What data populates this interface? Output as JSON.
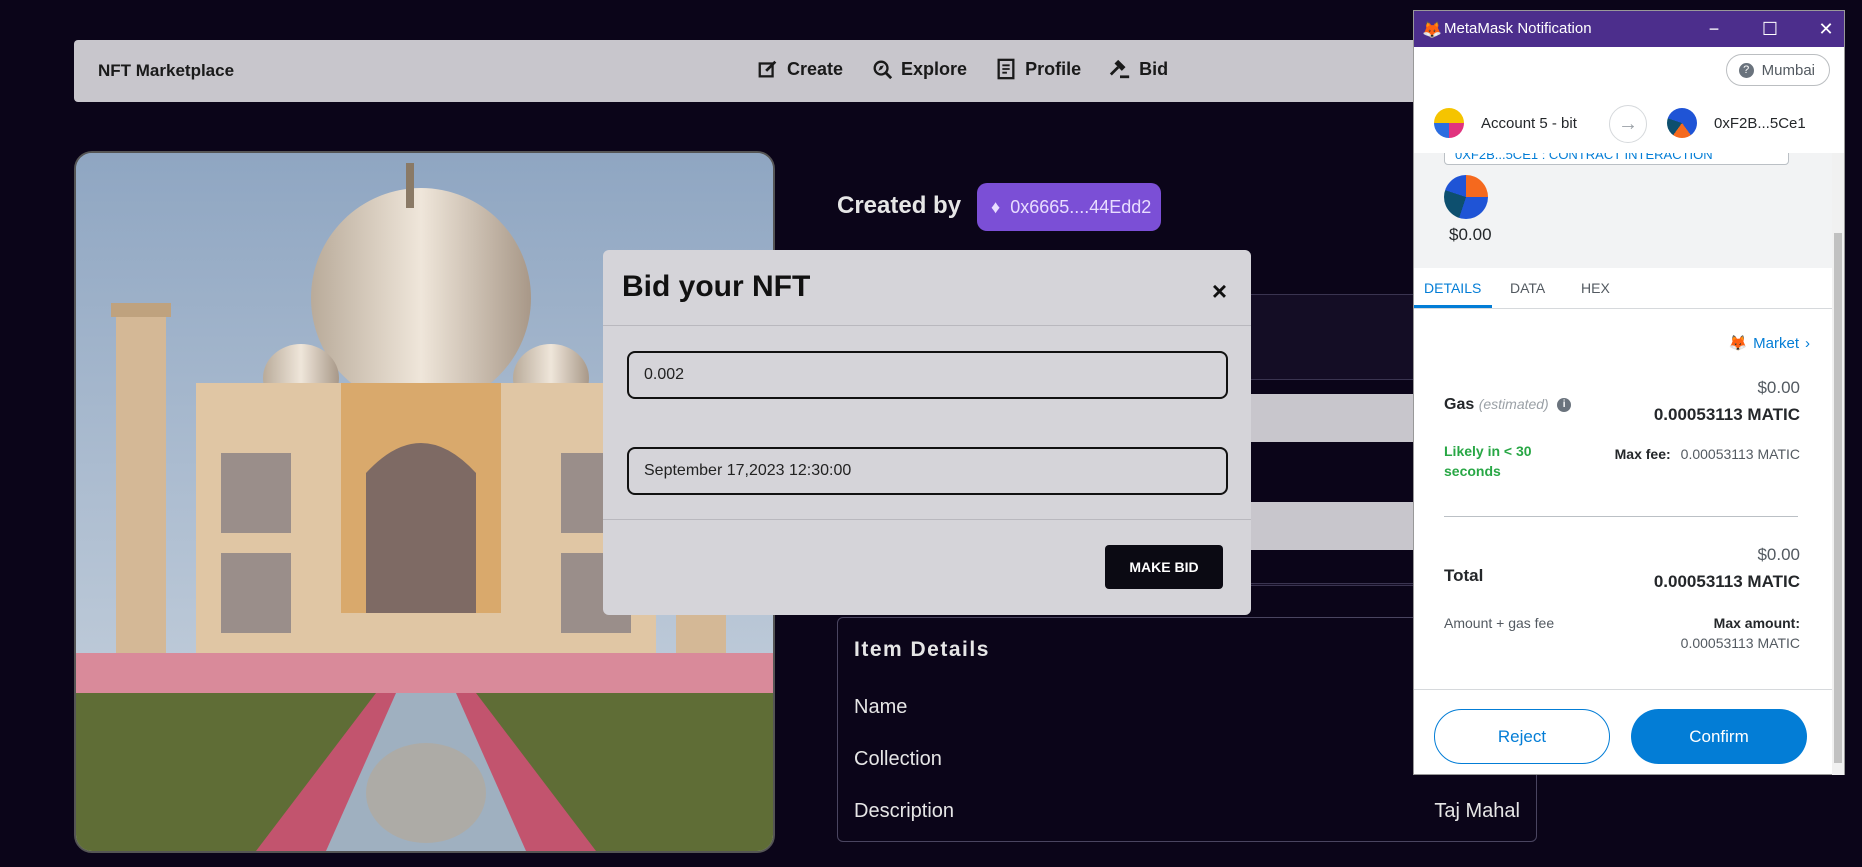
{
  "navbar": {
    "brand": "NFT Marketplace",
    "links": [
      "Create",
      "Explore",
      "Profile",
      "Bid"
    ]
  },
  "nft": {
    "created_by_label": "Created by",
    "owner": "0x6665....44Edd2",
    "details_title": "Item Details",
    "rows": [
      {
        "label": "Name",
        "value": ""
      },
      {
        "label": "Collection",
        "value": ""
      },
      {
        "label": "Description",
        "value": "Taj Mahal"
      }
    ]
  },
  "modal": {
    "title": "Bid your NFT",
    "close": "×",
    "amount_value": "0.002",
    "date_value": "September 17,2023 12:30:00",
    "submit_label": "MAKE BID"
  },
  "metamask": {
    "window_title": "MetaMask Notification",
    "network": "Mumbai",
    "from_account": "Account 5 - bit",
    "to_address": "0xF2B...5Ce1",
    "origin_tag": "0XF2B...5CE1 : CONTRACT INTERACTION",
    "origin_usd": "$0.00",
    "tabs": [
      "DETAILS",
      "DATA",
      "HEX"
    ],
    "market_label": "Market",
    "gas_label": "Gas",
    "gas_estimated": "(estimated)",
    "gas_usd": "$0.00",
    "gas_matic": "0.00053113 MATIC",
    "likely_text": "Likely in < 30 seconds",
    "max_fee_label": "Max fee:",
    "max_fee_value": "0.00053113 MATIC",
    "total_label": "Total",
    "total_usd": "$0.00",
    "total_matic": "0.00053113 MATIC",
    "amount_gas_label": "Amount + gas fee",
    "max_amount_label": "Max amount:",
    "max_amount_value": "0.00053113 MATIC",
    "reject_label": "Reject",
    "confirm_label": "Confirm"
  },
  "colors": {
    "background": "#0b0519",
    "navbar": "#c8c6cc",
    "owner_chip": "#7b4fd6",
    "metamask_blue": "#037dd6",
    "success_green": "#28a745"
  }
}
